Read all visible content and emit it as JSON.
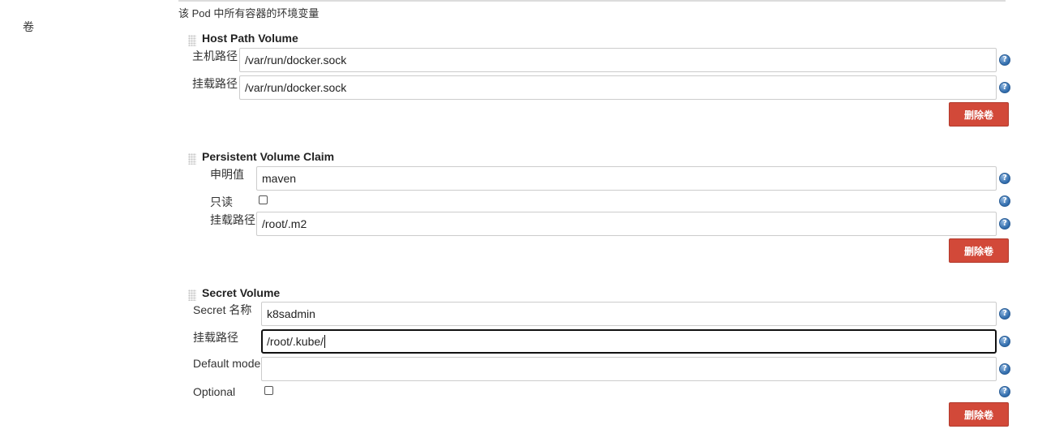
{
  "header": {
    "note": "该 Pod 中所有容器的环境变量"
  },
  "left_label": "卷",
  "host_path": {
    "title": "Host Path Volume",
    "host_path_label": "主机路径",
    "host_path_value": "/var/run/docker.sock",
    "mount_path_label": "挂载路径",
    "mount_path_value": "/var/run/docker.sock",
    "delete_label": "删除卷"
  },
  "pvc": {
    "title": "Persistent Volume Claim",
    "claim_label": "申明值",
    "claim_value": "maven",
    "readonly_label": "只读",
    "readonly_checked": false,
    "mount_path_label": "挂载路径",
    "mount_path_value": "/root/.m2",
    "delete_label": "删除卷"
  },
  "secret": {
    "title": "Secret Volume",
    "name_label": "Secret 名称",
    "name_value": "k8sadmin",
    "mount_path_label": "挂载路径",
    "mount_path_value": "/root/.kube/",
    "default_mode_label": "Default mode",
    "default_mode_value": "",
    "optional_label": "Optional",
    "optional_checked": false,
    "delete_label": "删除卷"
  },
  "help_icon_glyph": "?",
  "colors": {
    "danger": "#d24939",
    "help": "#2f6bab"
  }
}
